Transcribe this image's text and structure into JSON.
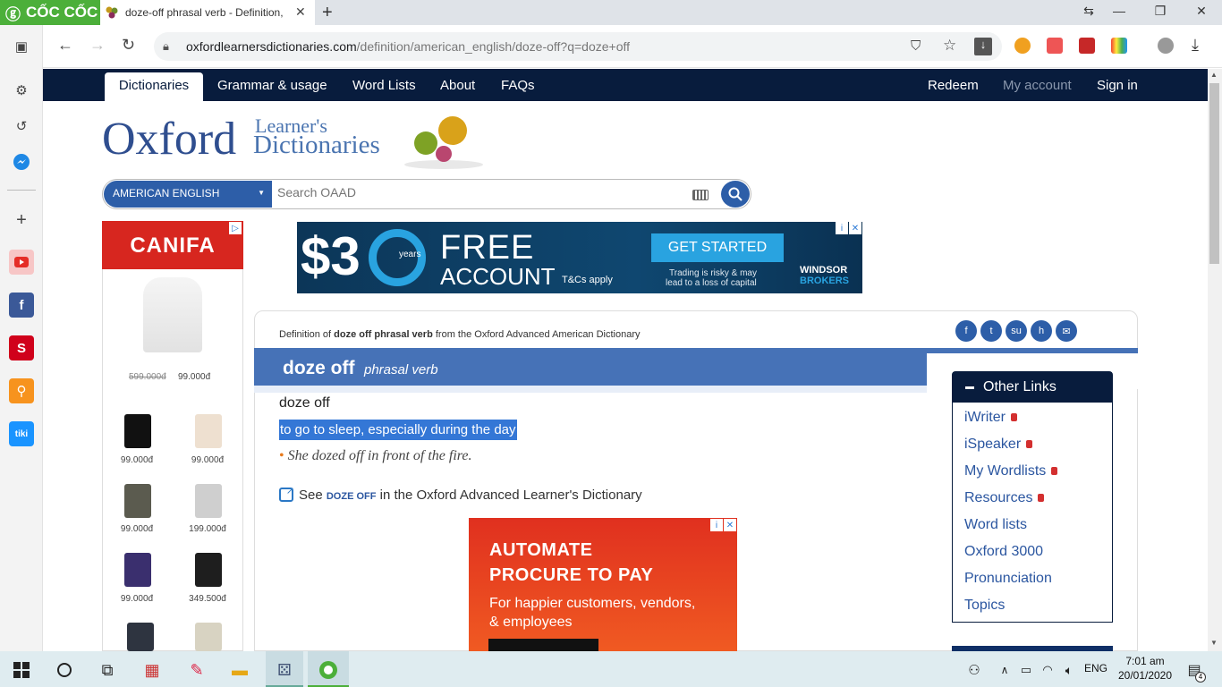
{
  "browser": {
    "brand": "CỐC CỐC",
    "tab_title": "doze-off phrasal verb - Definition,",
    "url_host": "oxfordlearnersdictionaries.com",
    "url_path": "/definition/american_english/doze-off?q=doze+off"
  },
  "site_nav": {
    "items": [
      "Dictionaries",
      "Grammar & usage",
      "Word Lists",
      "About",
      "FAQs"
    ],
    "right": [
      "Redeem",
      "My account",
      "Sign in"
    ]
  },
  "logo": {
    "oxford": "Oxford",
    "learners": "Learner's",
    "dictionaries": "Dictionaries"
  },
  "search": {
    "language": "AMERICAN ENGLISH",
    "placeholder": "Search OAAD"
  },
  "left_ad": {
    "brand": "CANIFA",
    "old_price": "599.000đ",
    "price": "99.000đ",
    "grid_prices": [
      "99.000đ",
      "99.000đ",
      "99.000đ",
      "199.000đ",
      "99.000đ",
      "349.500đ"
    ]
  },
  "banner_ad": {
    "big": "$3",
    "years": "years",
    "free": "FREE",
    "account": "ACCOUNT",
    "tc": "T&Cs apply",
    "cta": "GET STARTED",
    "risk1": "Trading is risky & may",
    "risk2": "lead  to a loss of capital",
    "logo": "WINDSOR",
    "logo2": "BROKERS"
  },
  "entry": {
    "def_of_prefix": "Definition of ",
    "def_of_word": "doze off phrasal verb",
    "def_of_suffix": " from the Oxford Advanced American Dictionary",
    "headword": "doze off",
    "pos": "phrasal verb",
    "phrase": "doze off",
    "definition": "to go to sleep, especially during the day",
    "example": "She dozed off in front of the fire.",
    "see_prefix": "See ",
    "see_word": "DOZE OFF",
    "see_suffix": " in the Oxford Advanced Learner's Dictionary"
  },
  "other_links": {
    "title": "Other Links",
    "items": [
      {
        "label": "iWriter",
        "locked": true
      },
      {
        "label": "iSpeaker",
        "locked": true
      },
      {
        "label": "My Wordlists",
        "locked": true
      },
      {
        "label": "Resources",
        "locked": true
      },
      {
        "label": "Word lists",
        "locked": false
      },
      {
        "label": "Oxford 3000",
        "locked": false
      },
      {
        "label": "Pronunciation",
        "locked": false
      },
      {
        "label": "Topics",
        "locked": false
      }
    ]
  },
  "bottom_ad": {
    "h1": "AUTOMATE",
    "h2": "PROCURE TO PAY",
    "sub1": "For happier customers, vendors,",
    "sub2": "& employees"
  },
  "taskbar": {
    "lang": "ENG",
    "time": "7:01 am",
    "date": "20/01/2020",
    "notifications": "4"
  },
  "colors": {
    "nav": "#081c3d",
    "accent": "#4672b7",
    "brand_green": "#4caf3a",
    "highlight": "#3477d6"
  }
}
